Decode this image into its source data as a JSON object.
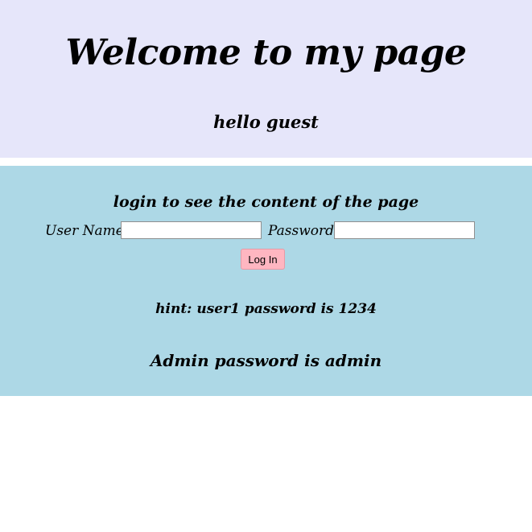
{
  "header": {
    "title": "Welcome to my page",
    "greeting": "hello guest"
  },
  "login": {
    "heading": "login to see the content of the page",
    "username_label": "User Name:",
    "username_value": "",
    "password_label": "Password:",
    "password_value": "",
    "button_label": "Log In",
    "hint": "hint: user1 password is 1234",
    "admin_hint": "Admin password is admin"
  },
  "colors": {
    "header_background": "#e6e6fa",
    "panel_background": "#add8e6",
    "button_background": "#ffb6c1"
  }
}
